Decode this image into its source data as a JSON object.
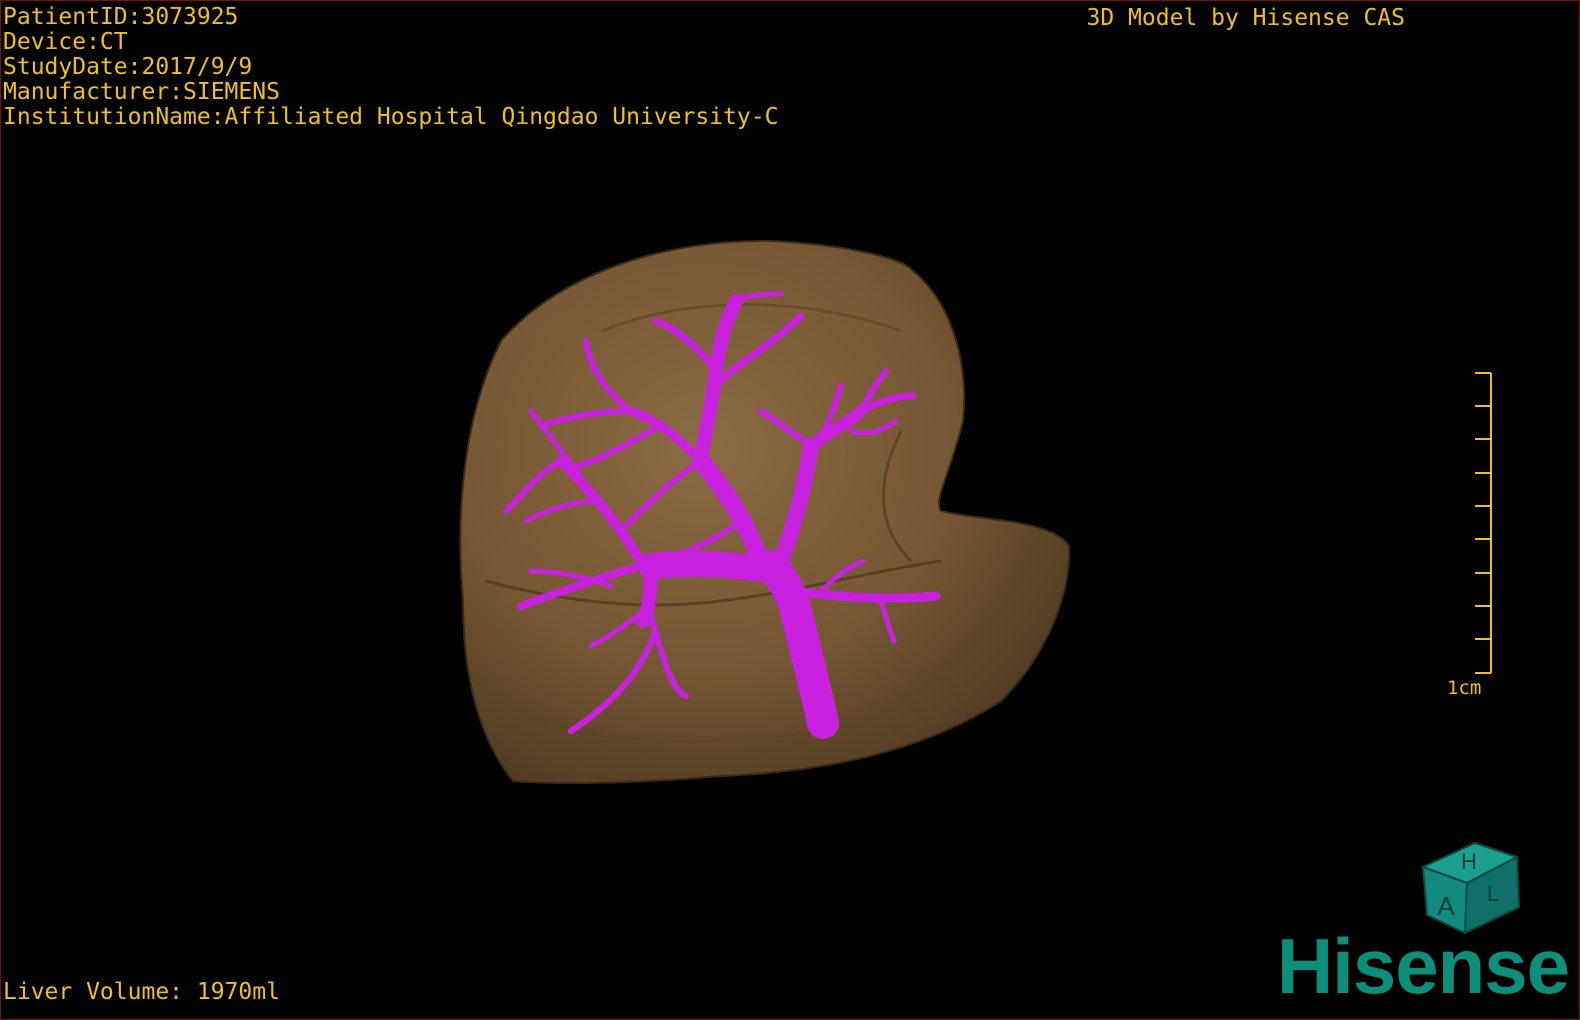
{
  "overlay": {
    "patient_id": "PatientID:3073925",
    "device": "Device:CT",
    "study_date": "StudyDate:2017/9/9",
    "manufacturer": "Manufacturer:SIEMENS",
    "institution": "InstitutionName:Affiliated Hospital Qingdao University-C",
    "credit": "3D Model by Hisense CAS",
    "liver_volume": "Liver Volume: 1970ml"
  },
  "scale": {
    "label": "1cm"
  },
  "orientation_cube": {
    "top_face": "H",
    "front_face": "A",
    "side_face": "L"
  },
  "logo": {
    "text": "Hisense"
  },
  "colors": {
    "overlay_text": "#f0c020",
    "liver": "#7a5c38",
    "vessels": "#c822e0",
    "logo": "#0b8f7a",
    "cube": "#138a80",
    "frame": "#7a1010"
  },
  "icons": {
    "liver": "liver-3d-model",
    "vessels": "hepatic-vessel-tree",
    "cube": "orientation-cube-icon"
  }
}
